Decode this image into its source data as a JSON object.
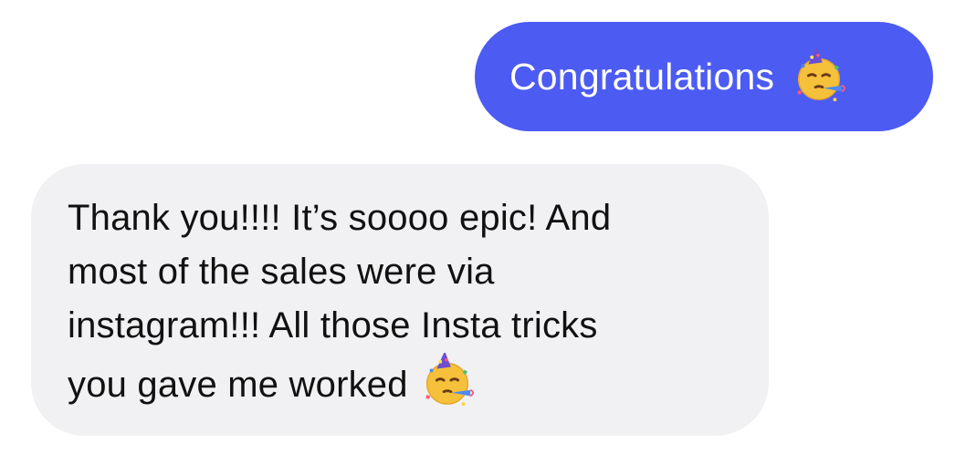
{
  "colors": {
    "outgoing_bubble": "#4c5bf2",
    "incoming_bubble": "#f1f1f3",
    "outgoing_text": "#ffffff",
    "incoming_text": "#111111"
  },
  "messages": {
    "outgoing": {
      "text": "Congratulations",
      "emoji": "partying-face-icon"
    },
    "incoming": {
      "lines": [
        "Thank you!!!! It’s soooo epic! And",
        "most of the sales were via",
        "instagram!!! All those Insta tricks",
        "you gave me worked"
      ],
      "emoji": "partying-face-icon"
    }
  }
}
